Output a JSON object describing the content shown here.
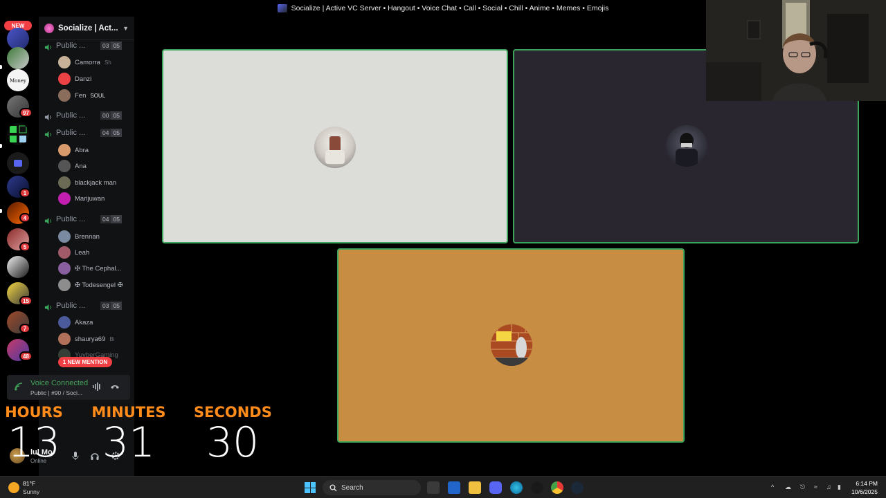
{
  "window": {
    "title": "Socialize | Active VC Server • Hangout • Voice Chat • Call • Social • Chill • Anime • Memes • Emojis"
  },
  "server_rail": {
    "new_label": "NEW",
    "badges": [
      "97",
      "1",
      "4",
      "5",
      "15",
      "7",
      "48"
    ]
  },
  "sidebar": {
    "server_name": "Socialize | Act...",
    "channels": [
      {
        "name": "Public ...",
        "count": "03",
        "limit": "05",
        "members": [
          {
            "name": "Camorra",
            "tag": "Sh",
            "color": "#c7b299"
          },
          {
            "name": "Danzi",
            "tag": "",
            "color": "#ed4245"
          },
          {
            "name": "Fen",
            "tag": "SOUL",
            "color": "#8a6d5a"
          }
        ]
      },
      {
        "name": "Public ...",
        "count": "00",
        "limit": "05",
        "members": []
      },
      {
        "name": "Public ...",
        "count": "04",
        "limit": "05",
        "members": [
          {
            "name": "Abra",
            "tag": "",
            "color": "#d89a6a"
          },
          {
            "name": "Ana",
            "tag": "",
            "color": "#555"
          },
          {
            "name": "blackjack man",
            "tag": "",
            "color": "#6b6b55"
          },
          {
            "name": "Marijuwan",
            "tag": "",
            "color": "#c21fb0"
          }
        ]
      },
      {
        "name": "Public ...",
        "count": "04",
        "limit": "05",
        "members": [
          {
            "name": "Brennan",
            "tag": "",
            "color": "#7a8aa0"
          },
          {
            "name": "Leah",
            "tag": "",
            "color": "#a05a6a"
          },
          {
            "name": "✠ The Cephal...",
            "tag": "",
            "color": "#8a5fa0"
          },
          {
            "name": "✠ Todesengel ✠",
            "tag": "",
            "color": "#8d8d8d"
          }
        ]
      },
      {
        "name": "Public ...",
        "count": "03",
        "limit": "05",
        "members": [
          {
            "name": "Akaza",
            "tag": "",
            "color": "#4a5a9a"
          },
          {
            "name": "shaurya69",
            "tag": "Bi",
            "color": "#b0705a"
          },
          {
            "name": "YuvberGaming",
            "tag": "",
            "color": "#5a6a5a"
          }
        ]
      }
    ],
    "mention_pill": "1 NEW MENTION",
    "voice": {
      "title": "Voice Connected",
      "subtitle": "Public | #90 / Soci..."
    },
    "user": {
      "name": "lul Mo",
      "status": "Online"
    }
  },
  "countdown": {
    "hours_label": "HOURS",
    "hours_value": "13",
    "minutes_label": "MINUTES",
    "minutes_value": "31",
    "seconds_label": "SECONDS",
    "seconds_value": "30",
    "label_color": "#ff8c1a"
  },
  "stage": {
    "tiles": [
      {
        "bg": "#dcdcd8"
      },
      {
        "bg": "#2a2630"
      },
      {
        "bg": "#c68d43"
      }
    ],
    "speaking_border_color": "#3ba55c"
  },
  "taskbar": {
    "weather_temp": "81°F",
    "weather_cond": "Sunny",
    "search_placeholder": "Search",
    "time": "6:14 PM",
    "date": "10/6/2025"
  }
}
